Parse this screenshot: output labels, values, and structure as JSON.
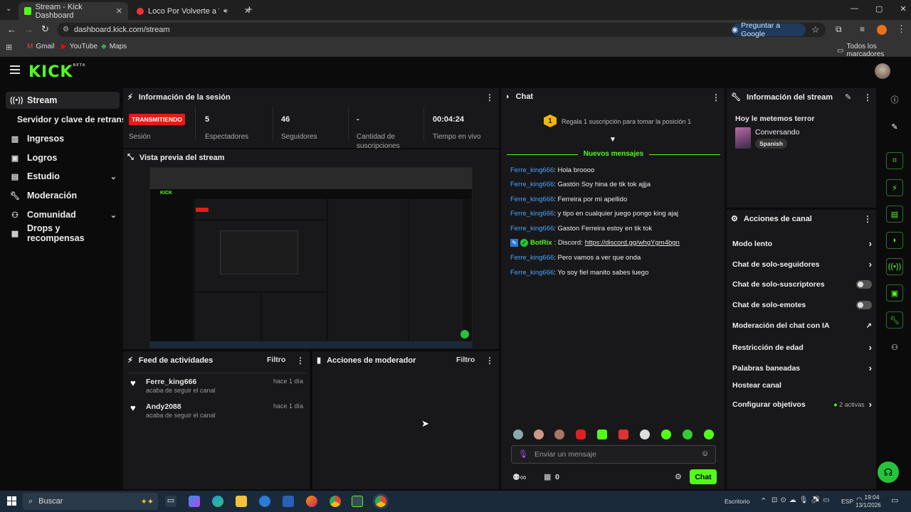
{
  "browser": {
    "tabs": [
      {
        "title": "Stream - Kick Dashboard"
      },
      {
        "title": "Loco Por Volverte a Ver - Yo"
      }
    ],
    "new_tab": "+",
    "window_controls": [
      "—",
      "▢",
      "✕"
    ],
    "url": "dashboard.kick.com/stream",
    "google_button": "Preguntar a Google",
    "bookmarks": [
      "Gmail",
      "YouTube",
      "Maps"
    ],
    "all_bookmarks": "Todos los marcadores"
  },
  "kick": {
    "logo": "KICK",
    "logo_badge": "BETA"
  },
  "sidebar": {
    "items": [
      {
        "label": "Stream",
        "icon": "broadcast-icon"
      },
      {
        "label": "Servidor y clave de retransm",
        "icon": ""
      },
      {
        "label": "Ingresos",
        "icon": "chart-icon"
      },
      {
        "label": "Logros",
        "icon": "trophy-icon"
      },
      {
        "label": "Estudio",
        "icon": "studio-icon"
      },
      {
        "label": "Moderación",
        "icon": "wrench-icon"
      },
      {
        "label": "Comunidad",
        "icon": "community-icon"
      },
      {
        "label": "Drops y recompensas",
        "icon": "gift-icon"
      }
    ]
  },
  "session": {
    "title": "Información de la sesión",
    "live_badge": "TRANSMITIENDO",
    "session_label": "Sesión",
    "stats": [
      {
        "value": "5",
        "label": "Espectadores"
      },
      {
        "value": "46",
        "label": "Seguidores"
      },
      {
        "value": "-",
        "label": "Cantidad de suscripciones"
      },
      {
        "value": "00:04:24",
        "label": "Tiempo en vivo"
      }
    ]
  },
  "preview": {
    "title": "Vista previa del stream"
  },
  "feed": {
    "title": "Feed de actividades",
    "filter": "Filtro",
    "items": [
      {
        "user": "Ferre_king666",
        "action": "acaba de seguir el canal",
        "time": "hace 1 día"
      },
      {
        "user": "Andy2088",
        "action": "acaba de seguir el canal",
        "time": "hace 1 día"
      }
    ]
  },
  "mod": {
    "title": "Acciones de moderador",
    "filter": "Filtro"
  },
  "chat": {
    "title": "Chat",
    "gift_rank": "1",
    "gift_text": "Regala 1 suscripción para tomar la posición 1",
    "new_messages": "Nuevos mensajes",
    "messages": [
      {
        "user": "Ferre_king666",
        "text": ": Hola broooo"
      },
      {
        "user": "Ferre_king666",
        "text": ": Gastón Soy hina de tik tok ajjja"
      },
      {
        "user": "Ferre_king666",
        "text": ": Ferreira por mi apellido"
      },
      {
        "user": "Ferre_king666",
        "text": ": y tipo en cualquier juego pongo king ajaj"
      },
      {
        "user": "Ferre_king666",
        "text": ": Gaston Ferreira estoy en tik tok"
      },
      {
        "user": "BotRix",
        "text": ": Discord: ",
        "link": "https://discord.gg/whgYgm4bgn"
      },
      {
        "user": "Ferre_king666",
        "text": ": Pero vamos a ver que onda"
      },
      {
        "user": "Ferre_king666",
        "text": ": Yo soy fiel manito sabes luego"
      }
    ],
    "input_placeholder": "Enviar un mensaje",
    "points": "0",
    "send_label": "Chat"
  },
  "stream_info": {
    "title": "Información del stream",
    "stream_title": "Hoy le metemos terror",
    "category": "Conversando",
    "language": "Spanish"
  },
  "channel_actions": {
    "title": "Acciones de canal",
    "items": [
      {
        "label": "Modo lento",
        "control": "arrow"
      },
      {
        "label": "Chat de solo-seguidores",
        "control": "arrow"
      },
      {
        "label": "Chat de solo-suscriptores",
        "control": "toggle"
      },
      {
        "label": "Chat de solo-emotes",
        "control": "toggle"
      },
      {
        "label": "Moderación del chat con IA",
        "control": "external"
      },
      {
        "label": "Restricción de edad",
        "control": "arrow"
      },
      {
        "label": "Palabras baneadas",
        "control": "arrow"
      },
      {
        "label": "Hostear canal",
        "control": "none"
      },
      {
        "label": "Configurar objetivos",
        "control": "arrow",
        "extra": "2 activas"
      }
    ]
  },
  "taskbar": {
    "search": "Buscar",
    "desktop": "Escritorio",
    "lang": "ESP",
    "time": "19:04",
    "date": "13/1/2026"
  },
  "colors": {
    "accent": "#53fc18",
    "live": "#e91916",
    "link": "#4aa3ff"
  }
}
